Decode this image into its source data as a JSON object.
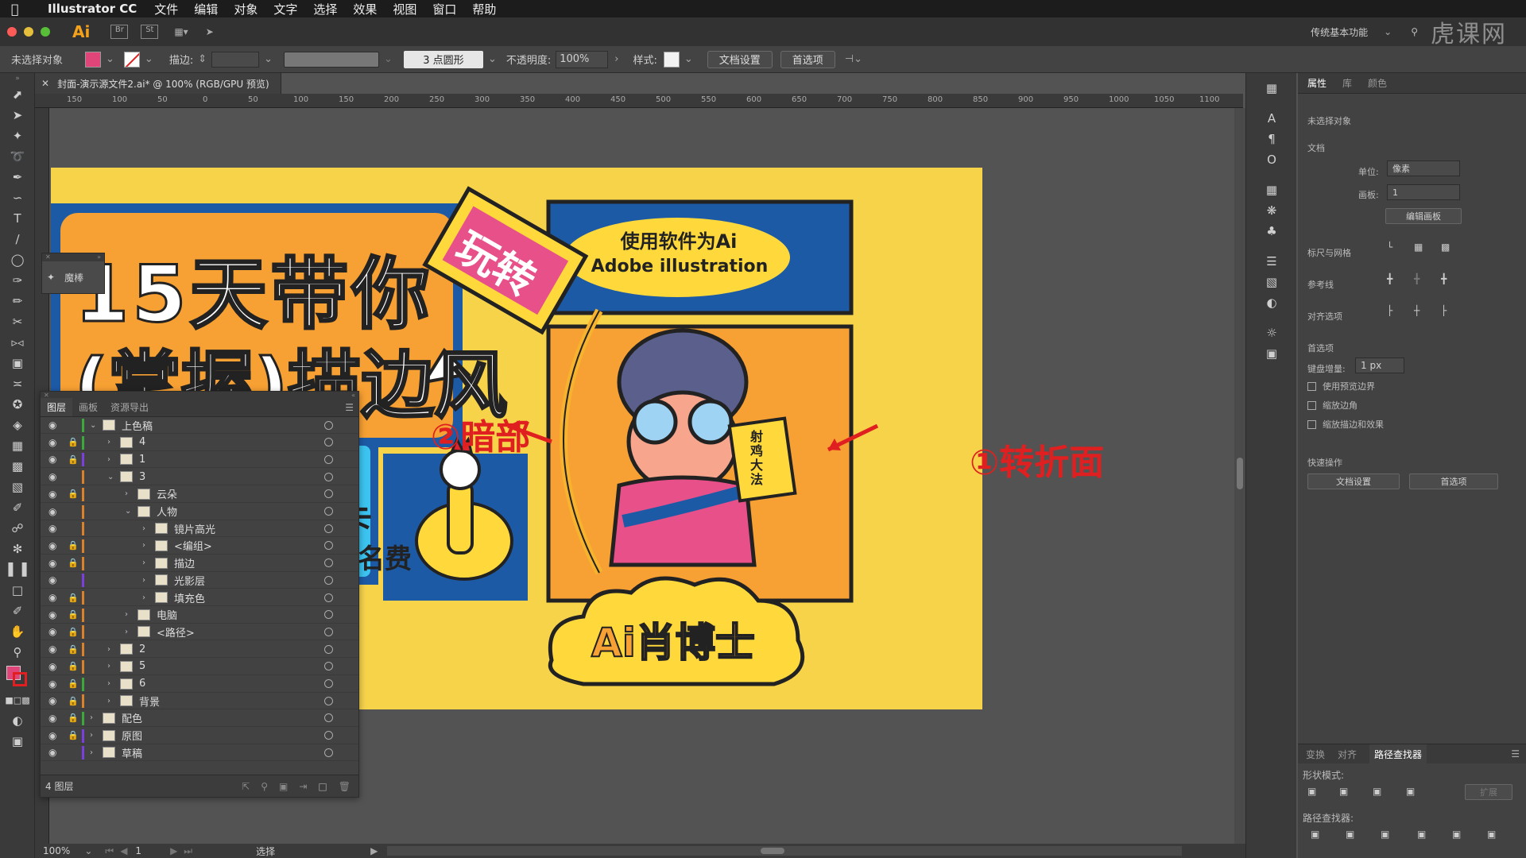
{
  "menubar": {
    "app_name": "Illustrator CC",
    "items": [
      "文件",
      "编辑",
      "对象",
      "文字",
      "选择",
      "效果",
      "视图",
      "窗口",
      "帮助"
    ]
  },
  "titlebar": {
    "app_logo": "Ai",
    "workspace": "传统基本功能",
    "watermark": "虎课网"
  },
  "control_bar": {
    "selection_status": "未选择对象",
    "stroke_label": "描边:",
    "brush_label": "3 点圆形",
    "opacity_label": "不透明度:",
    "opacity_value": "100%",
    "style_label": "样式:",
    "doc_setup_button": "文档设置",
    "prefs_button": "首选项",
    "fill_color": "#e0457a"
  },
  "document_tab": {
    "title": "封面-演示源文件2.ai* @ 100% (RGB/GPU 预览)"
  },
  "ruler_labels": [
    "150",
    "100",
    "50",
    "0",
    "50",
    "100",
    "150",
    "200",
    "250",
    "300",
    "350",
    "400",
    "450",
    "500",
    "550",
    "600",
    "650",
    "700",
    "750",
    "800",
    "850",
    "900",
    "950",
    "1000",
    "1050",
    "1100"
  ],
  "artwork": {
    "title_line1": "15天带你",
    "title_line2": "(掌握)描边风",
    "tag": "玩转",
    "bubble_line1": "使用软件为Ai",
    "bubble_line2": "Adobe illustration",
    "card_text1": "打卡",
    "card_text2": "退报名费",
    "book_text": "射鸡大法",
    "badge": "Ai肖博士",
    "annotation_dark": "②暗部",
    "annotation_fold": "①转折面"
  },
  "magic_panel": {
    "label": "魔棒"
  },
  "layers_panel": {
    "tabs": [
      "图层",
      "画板",
      "资源导出"
    ],
    "footer": "4 图层",
    "rows": [
      {
        "name": "上色稿",
        "indent": 0,
        "expanded": true,
        "lock": false,
        "color": "#3aa83a"
      },
      {
        "name": "4",
        "indent": 1,
        "expanded": false,
        "lock": true,
        "color": "#3aa83a"
      },
      {
        "name": "1",
        "indent": 1,
        "expanded": false,
        "lock": true,
        "color": "#7b3fe0"
      },
      {
        "name": "3",
        "indent": 1,
        "expanded": true,
        "lock": false,
        "color": "#d9822b"
      },
      {
        "name": "云朵",
        "indent": 2,
        "expanded": false,
        "lock": true,
        "color": "#d9822b"
      },
      {
        "name": "人物",
        "indent": 2,
        "expanded": true,
        "lock": false,
        "color": "#d9822b"
      },
      {
        "name": "镜片高光",
        "indent": 3,
        "expanded": false,
        "lock": false,
        "color": "#d9822b"
      },
      {
        "name": "<编组>",
        "indent": 3,
        "expanded": false,
        "lock": true,
        "color": "#d9822b"
      },
      {
        "name": "描边",
        "indent": 3,
        "expanded": false,
        "lock": true,
        "color": "#d9822b"
      },
      {
        "name": "光影层",
        "indent": 3,
        "expanded": false,
        "lock": false,
        "color": "#7b3fe0"
      },
      {
        "name": "填充色",
        "indent": 3,
        "expanded": false,
        "lock": true,
        "color": "#d9822b"
      },
      {
        "name": "电脑",
        "indent": 2,
        "expanded": false,
        "lock": true,
        "color": "#d9822b"
      },
      {
        "name": "<路径>",
        "indent": 2,
        "expanded": false,
        "lock": true,
        "color": "#d9822b"
      },
      {
        "name": "2",
        "indent": 1,
        "expanded": false,
        "lock": true,
        "color": "#d9822b"
      },
      {
        "name": "5",
        "indent": 1,
        "expanded": false,
        "lock": true,
        "color": "#d9822b"
      },
      {
        "name": "6",
        "indent": 1,
        "expanded": false,
        "lock": true,
        "color": "#3aa83a"
      },
      {
        "name": "背景",
        "indent": 1,
        "expanded": false,
        "lock": true,
        "color": "#d9822b"
      },
      {
        "name": "配色",
        "indent": 0,
        "expanded": false,
        "lock": true,
        "color": "#3aa83a"
      },
      {
        "name": "原图",
        "indent": 0,
        "expanded": false,
        "lock": true,
        "color": "#7b3fe0"
      },
      {
        "name": "草稿",
        "indent": 0,
        "expanded": false,
        "lock": false,
        "color": "#7b3fe0"
      }
    ]
  },
  "properties_panel": {
    "tabs": [
      "属性",
      "库",
      "颜色"
    ],
    "no_selection": "未选择对象",
    "doc_label": "文档",
    "unit_label": "单位:",
    "unit_value": "像素",
    "artboard_label": "画板:",
    "artboard_value": "1",
    "edit_artboard_button": "编辑画板",
    "rulers_grid": "标尺与网格",
    "guides": "参考线",
    "align": "对齐选项",
    "prefs": "首选项",
    "keyboard_increment_label": "键盘增量:",
    "keyboard_increment_value": "1 px",
    "cb_preview_bounds": "使用预览边界",
    "cb_scale_corners": "缩放边角",
    "cb_scale_strokes": "缩放描边和效果",
    "quick_actions": "快速操作",
    "doc_setup_button": "文档设置",
    "prefs_button": "首选项"
  },
  "pathfinder_panel": {
    "tabs": [
      "变换",
      "对齐",
      "路径查找器"
    ],
    "shape_modes": "形状模式:",
    "pathfinders": "路径查找器:",
    "expand_button": "扩展"
  },
  "status_bar": {
    "zoom": "100%",
    "page": "1",
    "mode": "选择"
  }
}
